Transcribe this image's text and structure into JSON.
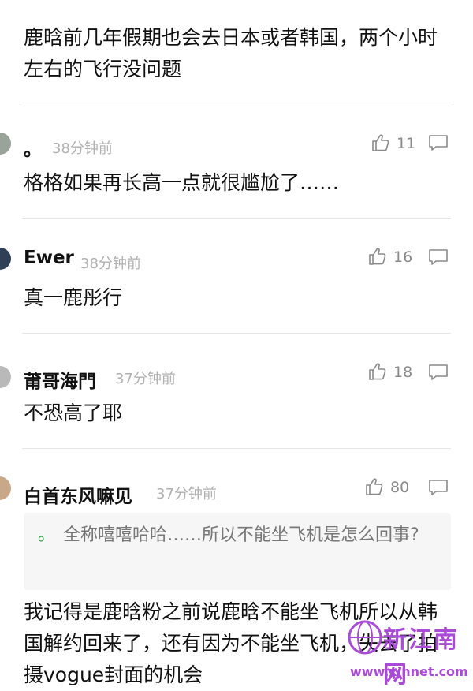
{
  "top_comment": {
    "text": "鹿晗前几年假期也会去日本或者韩国，两个小时左右的飞行没问题"
  },
  "comments": [
    {
      "username": "。",
      "time": "38分钟前",
      "likes": "11",
      "text": "格格如果再长高一点就很尴尬了……"
    },
    {
      "username": "Ewer",
      "time": "38分钟前",
      "likes": "16",
      "text": "真一鹿彤行"
    },
    {
      "username": "莆哥海門",
      "time": "37分钟前",
      "likes": "18",
      "text": "不恐高了耶"
    },
    {
      "username": "白首东风嘛见",
      "time": "37分钟前",
      "likes": "80",
      "quote_author": "。",
      "quote_text": "全称嘻嘻哈哈……所以不能坐飞机是怎么回事?",
      "text": "我记得是鹿晗粉之前说鹿晗不能坐飞机所以从韩国解约回来了，还有因为不能坐飞机，失去了拍摄vogue封面的机会"
    }
  ],
  "watermark": {
    "title": "新江南网",
    "url": "www.xjnnet.com"
  },
  "colors": {
    "accent_green": "#2e9e3a",
    "watermark_purple": "#a94bd6",
    "meta_gray": "#b0b0b0"
  },
  "icons": {
    "like": "thumbs-up-icon",
    "reply": "comment-bubble-icon"
  }
}
